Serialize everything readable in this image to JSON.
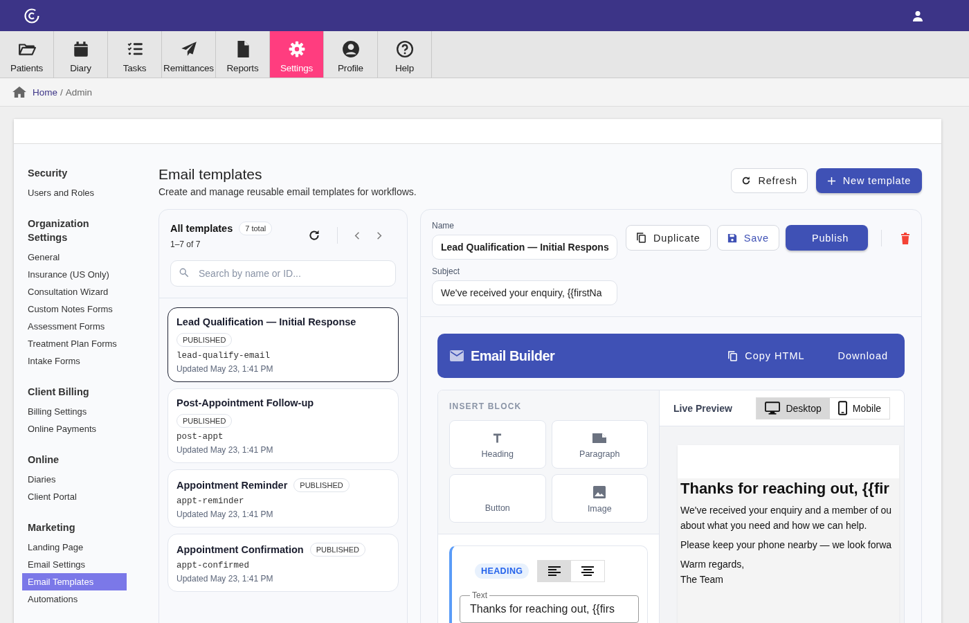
{
  "nav_tabs": [
    {
      "label": "Patients",
      "selected": false
    },
    {
      "label": "Diary",
      "selected": false
    },
    {
      "label": "Tasks",
      "selected": false
    },
    {
      "label": "Remittances",
      "selected": false
    },
    {
      "label": "Reports",
      "selected": false
    },
    {
      "label": "Settings",
      "selected": true
    },
    {
      "label": "Profile",
      "selected": false
    },
    {
      "label": "Help",
      "selected": false
    }
  ],
  "breadcrumb": {
    "home": "Home",
    "separator": "/",
    "current": "Admin"
  },
  "sidebar": {
    "sections": [
      {
        "title": "Security",
        "items": [
          {
            "label": "Users and Roles",
            "selected": false
          }
        ]
      },
      {
        "title": "Organization Settings",
        "items": [
          {
            "label": "General",
            "selected": false
          },
          {
            "label": "Insurance (US Only)",
            "selected": false
          },
          {
            "label": "Consultation Wizard",
            "selected": false
          },
          {
            "label": "Custom Notes Forms",
            "selected": false
          },
          {
            "label": "Assessment Forms",
            "selected": false
          },
          {
            "label": "Treatment Plan Forms",
            "selected": false
          },
          {
            "label": "Intake Forms",
            "selected": false
          }
        ]
      },
      {
        "title": "Client Billing",
        "items": [
          {
            "label": "Billing Settings",
            "selected": false
          },
          {
            "label": "Online Payments",
            "selected": false
          }
        ]
      },
      {
        "title": "Online",
        "items": [
          {
            "label": "Diaries",
            "selected": false
          },
          {
            "label": "Client Portal",
            "selected": false
          }
        ]
      },
      {
        "title": "Marketing",
        "items": [
          {
            "label": "Landing Page",
            "selected": false
          },
          {
            "label": "Email Settings",
            "selected": false
          },
          {
            "label": "Email Templates",
            "selected": true
          },
          {
            "label": "Automations",
            "selected": false
          }
        ]
      }
    ]
  },
  "page": {
    "title": "Email templates",
    "subtitle": "Create and manage reusable email templates for workflows.",
    "refresh_button": "Refresh",
    "new_button": "New template"
  },
  "template_list": {
    "title": "All templates",
    "count": "7 total",
    "range": "1–7 of 7",
    "search": {
      "placeholder": "Search by name or ID..."
    },
    "templates": [
      {
        "name": "Lead Qualification — Initial Response",
        "status": "PUBLISHED",
        "slug": "lead-qualify-email",
        "updated": "Updated May 23, 1:41 PM",
        "selected": true,
        "kind": "stacked"
      },
      {
        "name": "Post-Appointment Follow-up",
        "status": "PUBLISHED",
        "slug": "post-appt",
        "updated": "Updated May 23, 1:41 PM",
        "selected": false,
        "kind": "stacked"
      },
      {
        "name": "Appointment Reminder",
        "status": "PUBLISHED",
        "slug": "appt-reminder",
        "updated": "Updated May 23, 1:41 PM",
        "selected": false,
        "kind": "inline"
      },
      {
        "name": "Appointment Confirmation",
        "status": "PUBLISHED",
        "slug": "appt-confirmed",
        "updated": "Updated May 23, 1:41 PM",
        "selected": false,
        "kind": "inline"
      }
    ]
  },
  "editor": {
    "name_label": "Name",
    "name_value": "Lead Qualification — Initial Respons",
    "subject_label": "Subject",
    "subject_value": "We've received your enquiry, {{firstNa",
    "duplicate_button": "Duplicate",
    "save_button": "Save",
    "publish_button": "Publish"
  },
  "builder": {
    "title": "Email Builder",
    "copy_button": "Copy HTML",
    "download_button": "Download"
  },
  "insert_block": {
    "title": "INSERT BLOCK",
    "blocks": [
      {
        "label": "Heading",
        "kind": "heading"
      },
      {
        "label": "Paragraph",
        "kind": "paragraph"
      },
      {
        "label": "Button",
        "kind": "button"
      },
      {
        "label": "Image",
        "kind": "image"
      }
    ]
  },
  "block_editor": {
    "type": "HEADING",
    "alignments": [
      {
        "kind": "left",
        "selected": true
      },
      {
        "kind": "center",
        "selected": false
      }
    ],
    "text_label": "Text",
    "text_value": "Thanks for reaching out, {{firs"
  },
  "preview": {
    "title": "Live Preview",
    "devices": [
      {
        "label": "Desktop",
        "kind": "desktop",
        "selected": true
      },
      {
        "label": "Mobile",
        "kind": "mobile",
        "selected": false
      }
    ],
    "email": {
      "heading": "Thanks for reaching out, {{fir",
      "paragraphs": [
        [
          "We've received your enquiry and a member of ou",
          "about what you need and how we can help."
        ],
        [
          "Please keep your phone nearby — we look forwa"
        ],
        [
          "Warm regards,",
          "The Team"
        ]
      ]
    }
  }
}
